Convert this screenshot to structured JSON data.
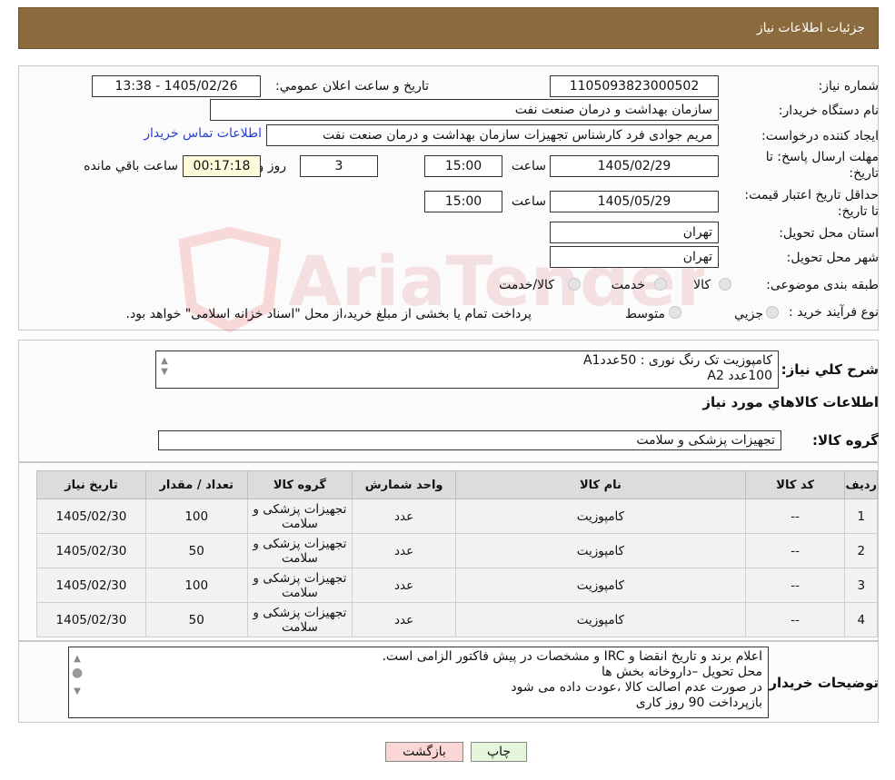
{
  "header": {
    "title": "جزئیات اطلاعات نیاز"
  },
  "form": {
    "need_number_label": "شماره نیاز:",
    "need_number": "1105093823000502",
    "announce_label": "تاریخ و ساعت اعلان عمومي:",
    "announce_value": "1405/02/26 - 13:38",
    "buyer_org_label": "نام دستگاه خریدار:",
    "buyer_org": "سازمان بهداشت و درمان صنعت نفت",
    "creator_label": "ایجاد کننده درخواست:",
    "creator": "مریم جوادی فرد کارشناس تجهیزات سازمان بهداشت و درمان صنعت نفت",
    "contact_link": "اطلاعات تماس خریدار",
    "deadline_label": "مهلت ارسال پاسخ: تا تاریخ:",
    "deadline_date": "1405/02/29",
    "time_label": "ساعت",
    "deadline_time": "15:00",
    "days_value": "3",
    "days_label": "روز و",
    "remaining_time": "00:17:18",
    "remaining_label": "ساعت باقي مانده",
    "validity_label": "حداقل تاریخ اعتبار قیمت: تا تاریخ:",
    "validity_date": "1405/05/29",
    "validity_time": "15:00",
    "province_label": "استان محل تحویل:",
    "province": "تهران",
    "city_label": "شهر محل تحویل:",
    "city": "تهران",
    "category_label": "طبقه بندی موضوعی:",
    "category_options": [
      "کالا",
      "خدمت",
      "کالا/خدمت"
    ],
    "process_label": "نوع فرآیند خرید :",
    "process_options": [
      "جزيي",
      "متوسط"
    ],
    "process_note": "پرداخت تمام یا بخشی از مبلغ خرید،از محل \"اسناد خزانه اسلامی\" خواهد بود."
  },
  "summary": {
    "title_label": "شرح كلي نياز:",
    "title_lines": [
      "کامپوزیت تک رنگ نوری : 50عددA1",
      "100عدد A2"
    ],
    "goods_info_title": "اطلاعات کالاهاي مورد نياز",
    "group_label": "گروه کالا:",
    "group_value": "تجهیزات پزشکی و سلامت"
  },
  "table": {
    "headers": [
      "ردیف",
      "کد کالا",
      "نام کالا",
      "واحد شمارش",
      "گروه کالا",
      "تعداد / مقدار",
      "تاریخ نیاز"
    ],
    "rows": [
      [
        "1",
        "--",
        "کامپوزیت",
        "عدد",
        "تجهیزات پزشکی و سلامت",
        "100",
        "1405/02/30"
      ],
      [
        "2",
        "--",
        "کامپوزیت",
        "عدد",
        "تجهیزات پزشکی و سلامت",
        "50",
        "1405/02/30"
      ],
      [
        "3",
        "--",
        "کامپوزیت",
        "عدد",
        "تجهیزات پزشکی و سلامت",
        "100",
        "1405/02/30"
      ],
      [
        "4",
        "--",
        "کامپوزیت",
        "عدد",
        "تجهیزات پزشکی و سلامت",
        "50",
        "1405/02/30"
      ]
    ]
  },
  "buyer_notes": {
    "label": "توضیحات خریدار:",
    "lines": [
      "اعلام برند و تاریخ انقضا  و IRC  و مشخصات در پیش فاکتور الزامی است.",
      "محل تحویل –داروخانه بخش ها",
      "در صورت عدم اصالت کالا ،عودت داده می شود",
      "بازپرداخت 90 روز کاری"
    ]
  },
  "buttons": {
    "print": "چاپ",
    "back": "بازگشت"
  },
  "watermark": {
    "text": "AriaTender.neT"
  },
  "colors": {
    "header_bg": "#8b6a3e",
    "link": "#2a3fd0",
    "back_button": "#fbd6d6",
    "print_button": "#e4f5d9"
  }
}
